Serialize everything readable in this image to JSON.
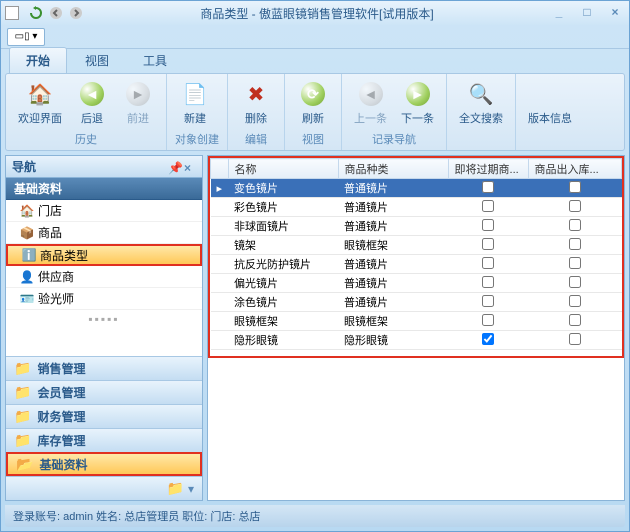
{
  "title": "商品类型 - 傲蓝眼镜销售管理软件[试用版本]",
  "tabs": {
    "t0": "开始",
    "t1": "视图",
    "t2": "工具"
  },
  "ribbon": {
    "history": {
      "title": "历史",
      "welcome": "欢迎界面",
      "back": "后退",
      "forward": "前进"
    },
    "create": {
      "title": "对象创建",
      "new": "新建"
    },
    "edit": {
      "title": "编辑",
      "delete": "删除"
    },
    "view": {
      "title": "视图",
      "refresh": "刷新"
    },
    "nav": {
      "title": "记录导航",
      "prev": "上一条",
      "next": "下一条"
    },
    "search": {
      "full": "全文搜索"
    },
    "info": {
      "version": "版本信息"
    }
  },
  "navPanel": {
    "title": "导航",
    "sectionTitle": "基础资料",
    "tree": {
      "i0": "门店",
      "i1": "商品",
      "i2": "商品类型",
      "i3": "供应商",
      "i4": "验光师"
    },
    "cats": {
      "c0": "销售管理",
      "c1": "会员管理",
      "c2": "财务管理",
      "c3": "库存管理",
      "c4": "基础资料"
    }
  },
  "grid": {
    "cols": {
      "c0": "名称",
      "c1": "商品种类",
      "c2": "即将过期商...",
      "c3": "商品出入库..."
    },
    "rows": [
      {
        "name": "变色镜片",
        "type": "普通镜片",
        "expiring": false,
        "inout": false
      },
      {
        "name": "彩色镜片",
        "type": "普通镜片",
        "expiring": false,
        "inout": false
      },
      {
        "name": "非球面镜片",
        "type": "普通镜片",
        "expiring": false,
        "inout": false
      },
      {
        "name": "镜架",
        "type": "眼镜框架",
        "expiring": false,
        "inout": false
      },
      {
        "name": "抗反光防护镜片",
        "type": "普通镜片",
        "expiring": false,
        "inout": false
      },
      {
        "name": "偏光镜片",
        "type": "普通镜片",
        "expiring": false,
        "inout": false
      },
      {
        "name": "涂色镜片",
        "type": "普通镜片",
        "expiring": false,
        "inout": false
      },
      {
        "name": "眼镜框架",
        "type": "眼镜框架",
        "expiring": false,
        "inout": false
      },
      {
        "name": "隐形眼镜",
        "type": "隐形眼镜",
        "expiring": true,
        "inout": false
      }
    ]
  },
  "status": "登录账号: admin  姓名: 总店管理员  职位:   门店: 总店"
}
